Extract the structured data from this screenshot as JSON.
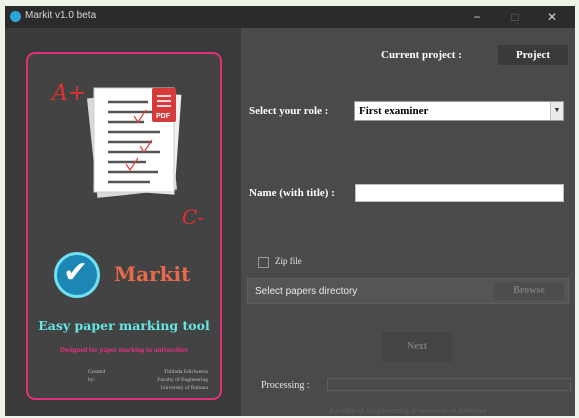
{
  "window": {
    "title": "Markit v1.0 beta",
    "minimize_glyph": "−",
    "maximize_glyph": "□",
    "close_glyph": "✕"
  },
  "branding": {
    "grade_top": "A+",
    "grade_bottom": "C-",
    "pdf_badge": "PDF",
    "logo_check": "✔",
    "app_name": "Markit",
    "tagline": "Easy paper marking tool",
    "subtagline": "Designed for paper marking in universities",
    "credits_label": "Created by:",
    "credits_lines": [
      "Thilinda Ediriweera",
      "Faculty of Engineering",
      "University of Ruhuna"
    ]
  },
  "form": {
    "current_project_label": "Current project :",
    "project_button": "Project",
    "role_label": "Select your role :",
    "role_value": "First examiner",
    "name_label": "Name (with title) :",
    "name_value": "",
    "zip_label": "Zip file",
    "zip_checked": false,
    "papers_dir_label": "Select papers directory",
    "browse_button": "Browse",
    "next_button": "Next",
    "processing_label": "Processing :",
    "progress": 0
  },
  "footer": "Faculty of Engineering, University of Ruhuna",
  "colors": {
    "accent_pink": "#e0307a",
    "brand_orange": "#e86a4a",
    "tagline_cyan": "#66e6e6",
    "logo_blue": "#1c86b4",
    "panel_dark": "#3a3a3a",
    "panel_mid": "#4a4a4a"
  }
}
